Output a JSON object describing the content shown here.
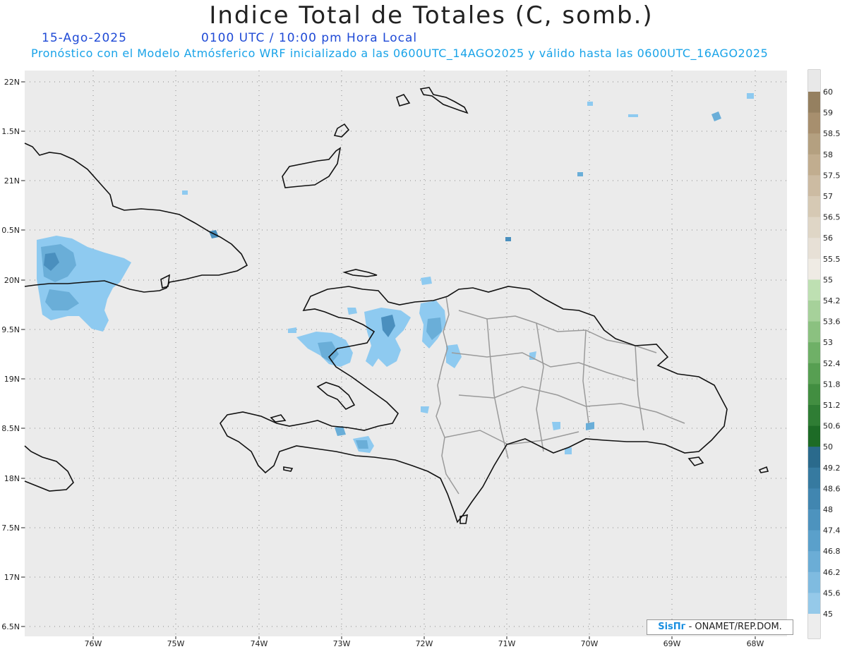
{
  "header": {
    "title": "Indice Total de Totales (C, somb.)",
    "date": "15-Ago-2025",
    "time": "0100 UTC / 10:00 pm Hora Local",
    "forecast": "Pronóstico con el Modelo Atmósferico WRF inicializado a las 0600UTC_14AGO2025 y válido hasta las  0600UTC_16AGO2025"
  },
  "axes": {
    "lat_labels": [
      "22N",
      "1.5N",
      "21N",
      "0.5N",
      "20N",
      "9.5N",
      "19N",
      "8.5N",
      "18N",
      "7.5N",
      "17N",
      "6.5N"
    ],
    "lon_labels": [
      "76W",
      "75W",
      "74W",
      "73W",
      "72W",
      "71W",
      "70W",
      "69W",
      "68W"
    ]
  },
  "colorbar": {
    "labels": [
      "60",
      "59",
      "58.5",
      "58",
      "57.5",
      "57",
      "56.5",
      "56",
      "55.5",
      "55",
      "54.2",
      "53.6",
      "53",
      "52.4",
      "51.8",
      "51.2",
      "50.6",
      "50",
      "49.2",
      "48.6",
      "48",
      "47.4",
      "46.8",
      "46.2",
      "45.6",
      "45"
    ],
    "colors": [
      "#958060",
      "#a78f6e",
      "#b4a080",
      "#c1ad8f",
      "#ccbba2",
      "#d6c9b4",
      "#dfd6c6",
      "#e7e0d6",
      "#efebe4",
      "#bee0b2",
      "#a6d19a",
      "#8bc180",
      "#6fb067",
      "#579f52",
      "#428e41",
      "#2f7d34",
      "#1d6b26",
      "#2a6a8c",
      "#367aa0",
      "#4186b0",
      "#4d93be",
      "#5aa0cb",
      "#6badd6",
      "#7fbbe0",
      "#95c9e9"
    ],
    "bottom_color": "#ededed",
    "top_color": "#e8e8e8"
  },
  "credit": {
    "logo": "SisПг",
    "text": "- ONAMET/REP.DOM."
  },
  "map_style": {
    "background": "#ebebeb",
    "coast_color": "#111111",
    "border_color": "#9a9a9a",
    "shade_light": "#8ecaf0",
    "shade_mid": "#6aaed8",
    "shade_dark": "#4a8fbe"
  }
}
